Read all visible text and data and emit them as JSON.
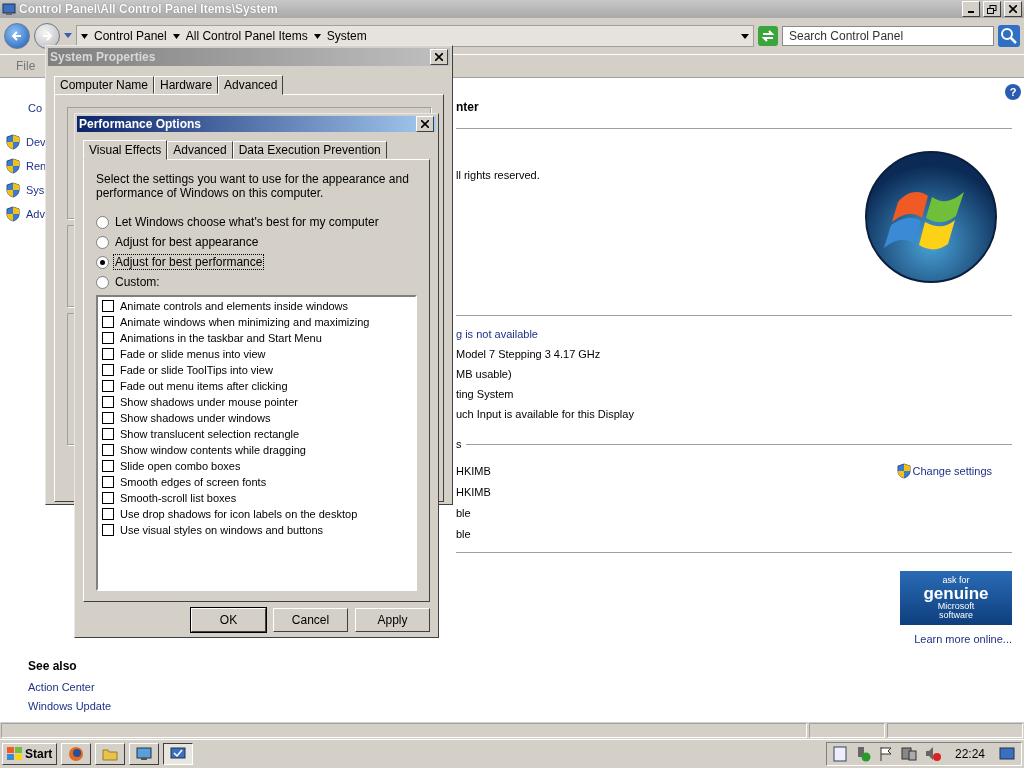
{
  "window": {
    "title": "Control Panel\\All Control Panel Items\\System"
  },
  "nav": {
    "breadcrumb": [
      "Control Panel",
      "All Control Panel Items",
      "System"
    ],
    "search": {
      "placeholder": "Search Control Panel"
    }
  },
  "menu": [
    "File"
  ],
  "sidebar": {
    "items": [
      {
        "label": "Co",
        "kind": "plain"
      },
      {
        "label": "Dev",
        "kind": "shield"
      },
      {
        "label": "Ren",
        "kind": "shield"
      },
      {
        "label": "Sys",
        "kind": "shield"
      },
      {
        "label": "Adv",
        "kind": "shield"
      }
    ],
    "see_also": {
      "heading": "See also",
      "links": [
        "Action Center",
        "Windows Update"
      ]
    }
  },
  "content": {
    "help": "?",
    "heading": "nter",
    "copyright": "ll rights reserved.",
    "rating_link": "g is not available",
    "specs": [
      "Model 7 Stepping 3   4.17 GHz",
      "MB usable)",
      "ting System",
      "uch Input is available for this Display"
    ],
    "section_label": "s",
    "computer_rows": [
      "HKIMB",
      "HKIMB",
      "ble",
      "ble"
    ],
    "change_settings": "Change settings",
    "genuine": {
      "lines": [
        "ask for",
        "genuine",
        "Microsoft",
        "software"
      ],
      "link": "Learn more online..."
    }
  },
  "system_properties": {
    "title": "System Properties",
    "tabs": [
      {
        "label": "Computer Name",
        "selected": false
      },
      {
        "label": "Hardware",
        "selected": false
      },
      {
        "label": "Advanced",
        "selected": true
      }
    ]
  },
  "performance_options": {
    "title": "Performance Options",
    "tabs": [
      {
        "label": "Visual Effects",
        "selected": true
      },
      {
        "label": "Advanced",
        "selected": false
      },
      {
        "label": "Data Execution Prevention",
        "selected": false
      }
    ],
    "description": "Select the settings you want to use for the appearance and performance of Windows on this computer.",
    "radios": [
      {
        "label": "Let Windows choose what's best for my computer",
        "selected": false
      },
      {
        "label": "Adjust for best appearance",
        "selected": false
      },
      {
        "label": "Adjust for best performance",
        "selected": true
      },
      {
        "label": "Custom:",
        "selected": false
      }
    ],
    "effects": [
      {
        "label": "Animate controls and elements inside windows",
        "checked": false
      },
      {
        "label": "Animate windows when minimizing and maximizing",
        "checked": false
      },
      {
        "label": "Animations in the taskbar and Start Menu",
        "checked": false
      },
      {
        "label": "Fade or slide menus into view",
        "checked": false
      },
      {
        "label": "Fade or slide ToolTips into view",
        "checked": false
      },
      {
        "label": "Fade out menu items after clicking",
        "checked": false
      },
      {
        "label": "Show shadows under mouse pointer",
        "checked": false
      },
      {
        "label": "Show shadows under windows",
        "checked": false
      },
      {
        "label": "Show translucent selection rectangle",
        "checked": false
      },
      {
        "label": "Show window contents while dragging",
        "checked": false
      },
      {
        "label": "Slide open combo boxes",
        "checked": false
      },
      {
        "label": "Smooth edges of screen fonts",
        "checked": false
      },
      {
        "label": "Smooth-scroll list boxes",
        "checked": false
      },
      {
        "label": "Use drop shadows for icon labels on the desktop",
        "checked": false
      },
      {
        "label": "Use visual styles on windows and buttons",
        "checked": false
      }
    ],
    "buttons": [
      "OK",
      "Cancel",
      "Apply"
    ]
  },
  "taskbar": {
    "start": "Start",
    "clock": "22:24"
  }
}
